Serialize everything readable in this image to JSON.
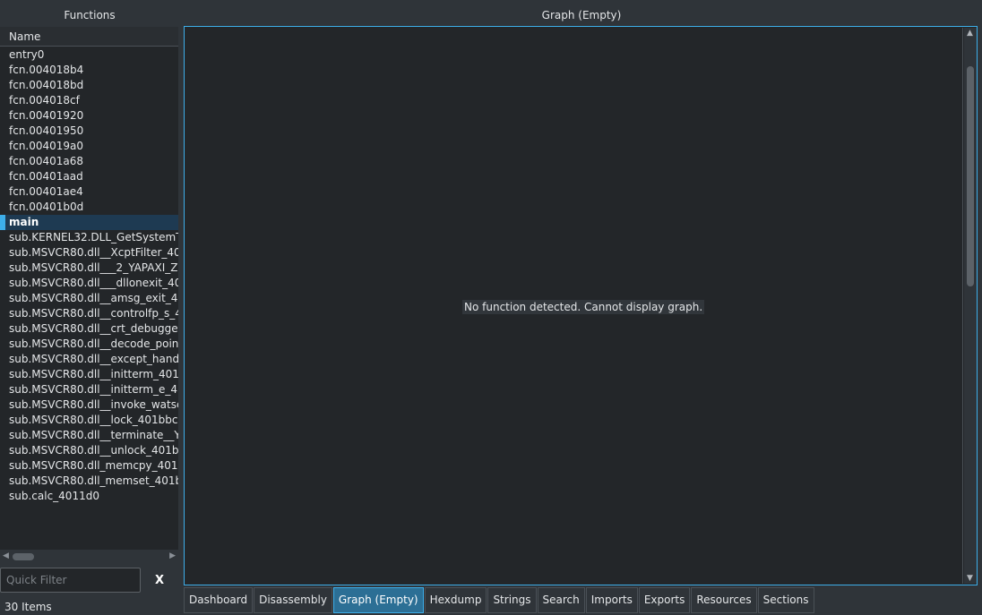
{
  "functions_panel": {
    "title": "Functions",
    "column_header": "Name",
    "items": [
      {
        "label": "entry0"
      },
      {
        "label": "fcn.004018b4"
      },
      {
        "label": "fcn.004018bd"
      },
      {
        "label": "fcn.004018cf"
      },
      {
        "label": "fcn.00401920"
      },
      {
        "label": "fcn.00401950"
      },
      {
        "label": "fcn.004019a0"
      },
      {
        "label": "fcn.00401a68"
      },
      {
        "label": "fcn.00401aad"
      },
      {
        "label": "fcn.00401ae4"
      },
      {
        "label": "fcn.00401b0d"
      },
      {
        "label": "main",
        "selected": true
      },
      {
        "label": "sub.KERNEL32.DLL_GetSystemT"
      },
      {
        "label": "sub.MSVCR80.dll__XcptFilter_40"
      },
      {
        "label": "sub.MSVCR80.dll___2_YAPAXI_Z"
      },
      {
        "label": "sub.MSVCR80.dll___dllonexit_40"
      },
      {
        "label": "sub.MSVCR80.dll__amsg_exit_4"
      },
      {
        "label": "sub.MSVCR80.dll__controlfp_s_4"
      },
      {
        "label": "sub.MSVCR80.dll__crt_debugge"
      },
      {
        "label": "sub.MSVCR80.dll__decode_poin"
      },
      {
        "label": "sub.MSVCR80.dll__except_hand"
      },
      {
        "label": "sub.MSVCR80.dll__initterm_401"
      },
      {
        "label": "sub.MSVCR80.dll__initterm_e_4"
      },
      {
        "label": "sub.MSVCR80.dll__invoke_watsc"
      },
      {
        "label": "sub.MSVCR80.dll__lock_401bbc"
      },
      {
        "label": "sub.MSVCR80.dll__terminate__Y"
      },
      {
        "label": "sub.MSVCR80.dll__unlock_401b"
      },
      {
        "label": "sub.MSVCR80.dll_memcpy_401"
      },
      {
        "label": "sub.MSVCR80.dll_memset_401b"
      },
      {
        "label": "sub.calc_4011d0"
      }
    ],
    "filter": {
      "placeholder": "Quick Filter",
      "value": "",
      "clear_label": "X"
    },
    "item_count": "30 Items"
  },
  "graph_panel": {
    "title": "Graph (Empty)",
    "message": "No function detected. Cannot display graph."
  },
  "tabs": [
    {
      "label": "Dashboard"
    },
    {
      "label": "Disassembly"
    },
    {
      "label": "Graph (Empty)",
      "active": true
    },
    {
      "label": "Hexdump"
    },
    {
      "label": "Strings"
    },
    {
      "label": "Search"
    },
    {
      "label": "Imports"
    },
    {
      "label": "Exports"
    },
    {
      "label": "Resources"
    },
    {
      "label": "Sections"
    }
  ],
  "colors": {
    "accent": "#3daee9",
    "background": "#2f3439",
    "panel": "#232629"
  },
  "icons": {
    "scroll_left": "◀",
    "scroll_right": "▶",
    "scroll_up": "▲",
    "scroll_down": "▼"
  }
}
